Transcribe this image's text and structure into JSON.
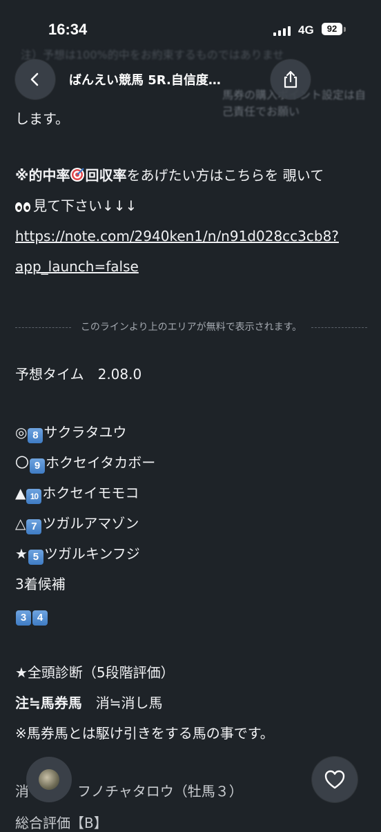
{
  "status": {
    "time": "16:34",
    "network": "4G",
    "battery": "92"
  },
  "ghost": {
    "line1": "注）予想は100%的中をお約束するものではありませ",
    "line2": "馬券の購入ポイント設定は自己責任でお願い"
  },
  "nav": {
    "title": "ばんえい競馬 5R.自信度…"
  },
  "article": {
    "line_shimasu": "します。",
    "promo_bold_1": "※的中率",
    "promo_bold_2": "回収率",
    "promo_rest": "をあげたい方はこちらを 覗いて",
    "promo_line2": "見て下さい↓↓↓",
    "link_line1": "https://note.com/2940ken1/n/n91d028cc3cb8?",
    "link_line2": "app_launch=false",
    "divider_text": "このラインより上のエリアが無料で表示されます。",
    "yoso_time": "予想タイム　2.08.0",
    "picks": [
      {
        "mark": "◎",
        "num": "8",
        "name": "サクラタユウ"
      },
      {
        "mark": "〇",
        "num": "9",
        "name": "ホクセイタカボー"
      },
      {
        "mark": "▲",
        "num": "10",
        "name": "ホクセイモモコ"
      },
      {
        "mark": "△",
        "num": "7",
        "name": "ツガルアマゾン"
      },
      {
        "mark": "★",
        "num": "5",
        "name": "ツガルキンフジ"
      }
    ],
    "third_label": "3着候補",
    "third_nums": [
      "3",
      "4"
    ],
    "diagnosis": "★全頭診断（5段階評価）",
    "legend_bold": "注≒馬券馬",
    "legend_rest": "　消≒消し馬",
    "note": "※馬券馬とは駆け引きをする馬の事です。",
    "bottom_horse_prefix": "消",
    "bottom_horse": "フノチャタロウ（牡馬３）",
    "bottom_rating": "総合評価【B】"
  }
}
